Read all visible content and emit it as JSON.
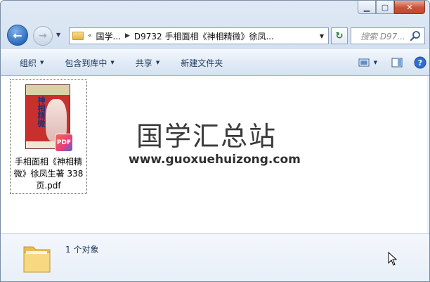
{
  "window": {
    "caption_buttons": {
      "minimize": "minimize-icon",
      "maximize": "maximize-icon",
      "close": "close-icon"
    }
  },
  "navigation": {
    "back_icon": "back-arrow-icon",
    "forward_icon": "forward-arrow-icon",
    "address": {
      "overflow": "«",
      "crumbs": [
        "国学...",
        "D9732 手相面相《神相精微》徐凤..."
      ]
    },
    "search_placeholder": "搜索 D97..."
  },
  "commandbar": {
    "organize": "组织",
    "include_in_library": "包含到库中",
    "share": "共享",
    "new_folder": "新建文件夹"
  },
  "content": {
    "file": {
      "name": "手相面相《神相精微》徐凤生著 338页.pdf",
      "name_lines": [
        "手相面相《神相精",
        "微》徐凤生著 338",
        "页.pdf"
      ],
      "badge": "PDF",
      "cover_title": "神相精微"
    },
    "watermark": {
      "title": "国学汇总站",
      "url": "www.guoxuehuizong.com"
    }
  },
  "details": {
    "count": "1 个对象"
  },
  "colors": {
    "chrome": "#dbe6f3",
    "text": "#1e395b",
    "close": "#c8533a"
  }
}
